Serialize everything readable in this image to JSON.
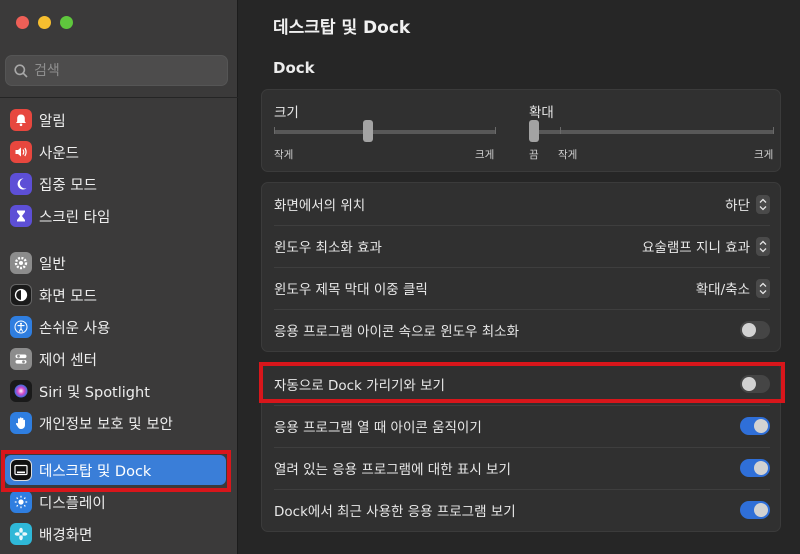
{
  "window": {
    "traffic_colors": [
      "#ee5f57",
      "#f6be2f",
      "#5fc73d"
    ]
  },
  "search": {
    "placeholder": "검색"
  },
  "sidebar": {
    "items": [
      {
        "label": "알림",
        "icon": "bell-icon",
        "color": "#e7473e"
      },
      {
        "label": "사운드",
        "icon": "speaker-icon",
        "color": "#e7473e"
      },
      {
        "label": "집중 모드",
        "icon": "moon-icon",
        "color": "#5d4fd6"
      },
      {
        "label": "스크린 타임",
        "icon": "hourglass-icon",
        "color": "#5d4fd6"
      },
      {
        "label": "일반",
        "icon": "gear-icon",
        "color": "#8c8c8c"
      },
      {
        "label": "화면 모드",
        "icon": "appearance-icon",
        "color": "#1b1b1b"
      },
      {
        "label": "손쉬운 사용",
        "icon": "accessibility-icon",
        "color": "#2f7ee0"
      },
      {
        "label": "제어 센터",
        "icon": "control-center-icon",
        "color": "#8c8c8c"
      },
      {
        "label": "Siri 및 Spotlight",
        "icon": "siri-icon",
        "color": "#c63fb8"
      },
      {
        "label": "개인정보 보호 및 보안",
        "icon": "hand-icon",
        "color": "#2f7ee0"
      },
      {
        "label": "데스크탑 및 Dock",
        "icon": "dock-icon",
        "color": "#111111",
        "selected": true
      },
      {
        "label": "디스플레이",
        "icon": "sun-icon",
        "color": "#2f7ee0"
      },
      {
        "label": "배경화면",
        "icon": "flower-icon",
        "color": "#2fb8d8"
      }
    ]
  },
  "main": {
    "title": "데스크탑 및 Dock",
    "section": "Dock",
    "size_slider": {
      "label": "크기",
      "min_label": "작게",
      "max_label": "크게",
      "level": 0.42
    },
    "magnify_slider": {
      "label": "확대",
      "off_label": "끔",
      "min_label": "작게",
      "max_label": "크게",
      "level": 0.0
    },
    "rows": [
      {
        "label": "화면에서의 위치",
        "type": "select",
        "value": "하단"
      },
      {
        "label": "윈도우 최소화 효과",
        "type": "select",
        "value": "요술램프 지니 효과"
      },
      {
        "label": "윈도우 제목 막대 이중 클릭",
        "type": "select",
        "value": "확대/축소"
      },
      {
        "label": "응용 프로그램 아이콘 속으로 윈도우 최소화",
        "type": "toggle",
        "on": false
      }
    ],
    "rows2": [
      {
        "label": "자동으로 Dock 가리기와 보기",
        "type": "toggle",
        "on": false
      },
      {
        "label": "응용 프로그램 열 때 아이콘 움직이기",
        "type": "toggle",
        "on": true
      },
      {
        "label": "열려 있는 응용 프로그램에 대한 표시 보기",
        "type": "toggle",
        "on": true
      },
      {
        "label": "Dock에서 최근 사용한 응용 프로그램 보기",
        "type": "toggle",
        "on": true
      }
    ]
  }
}
